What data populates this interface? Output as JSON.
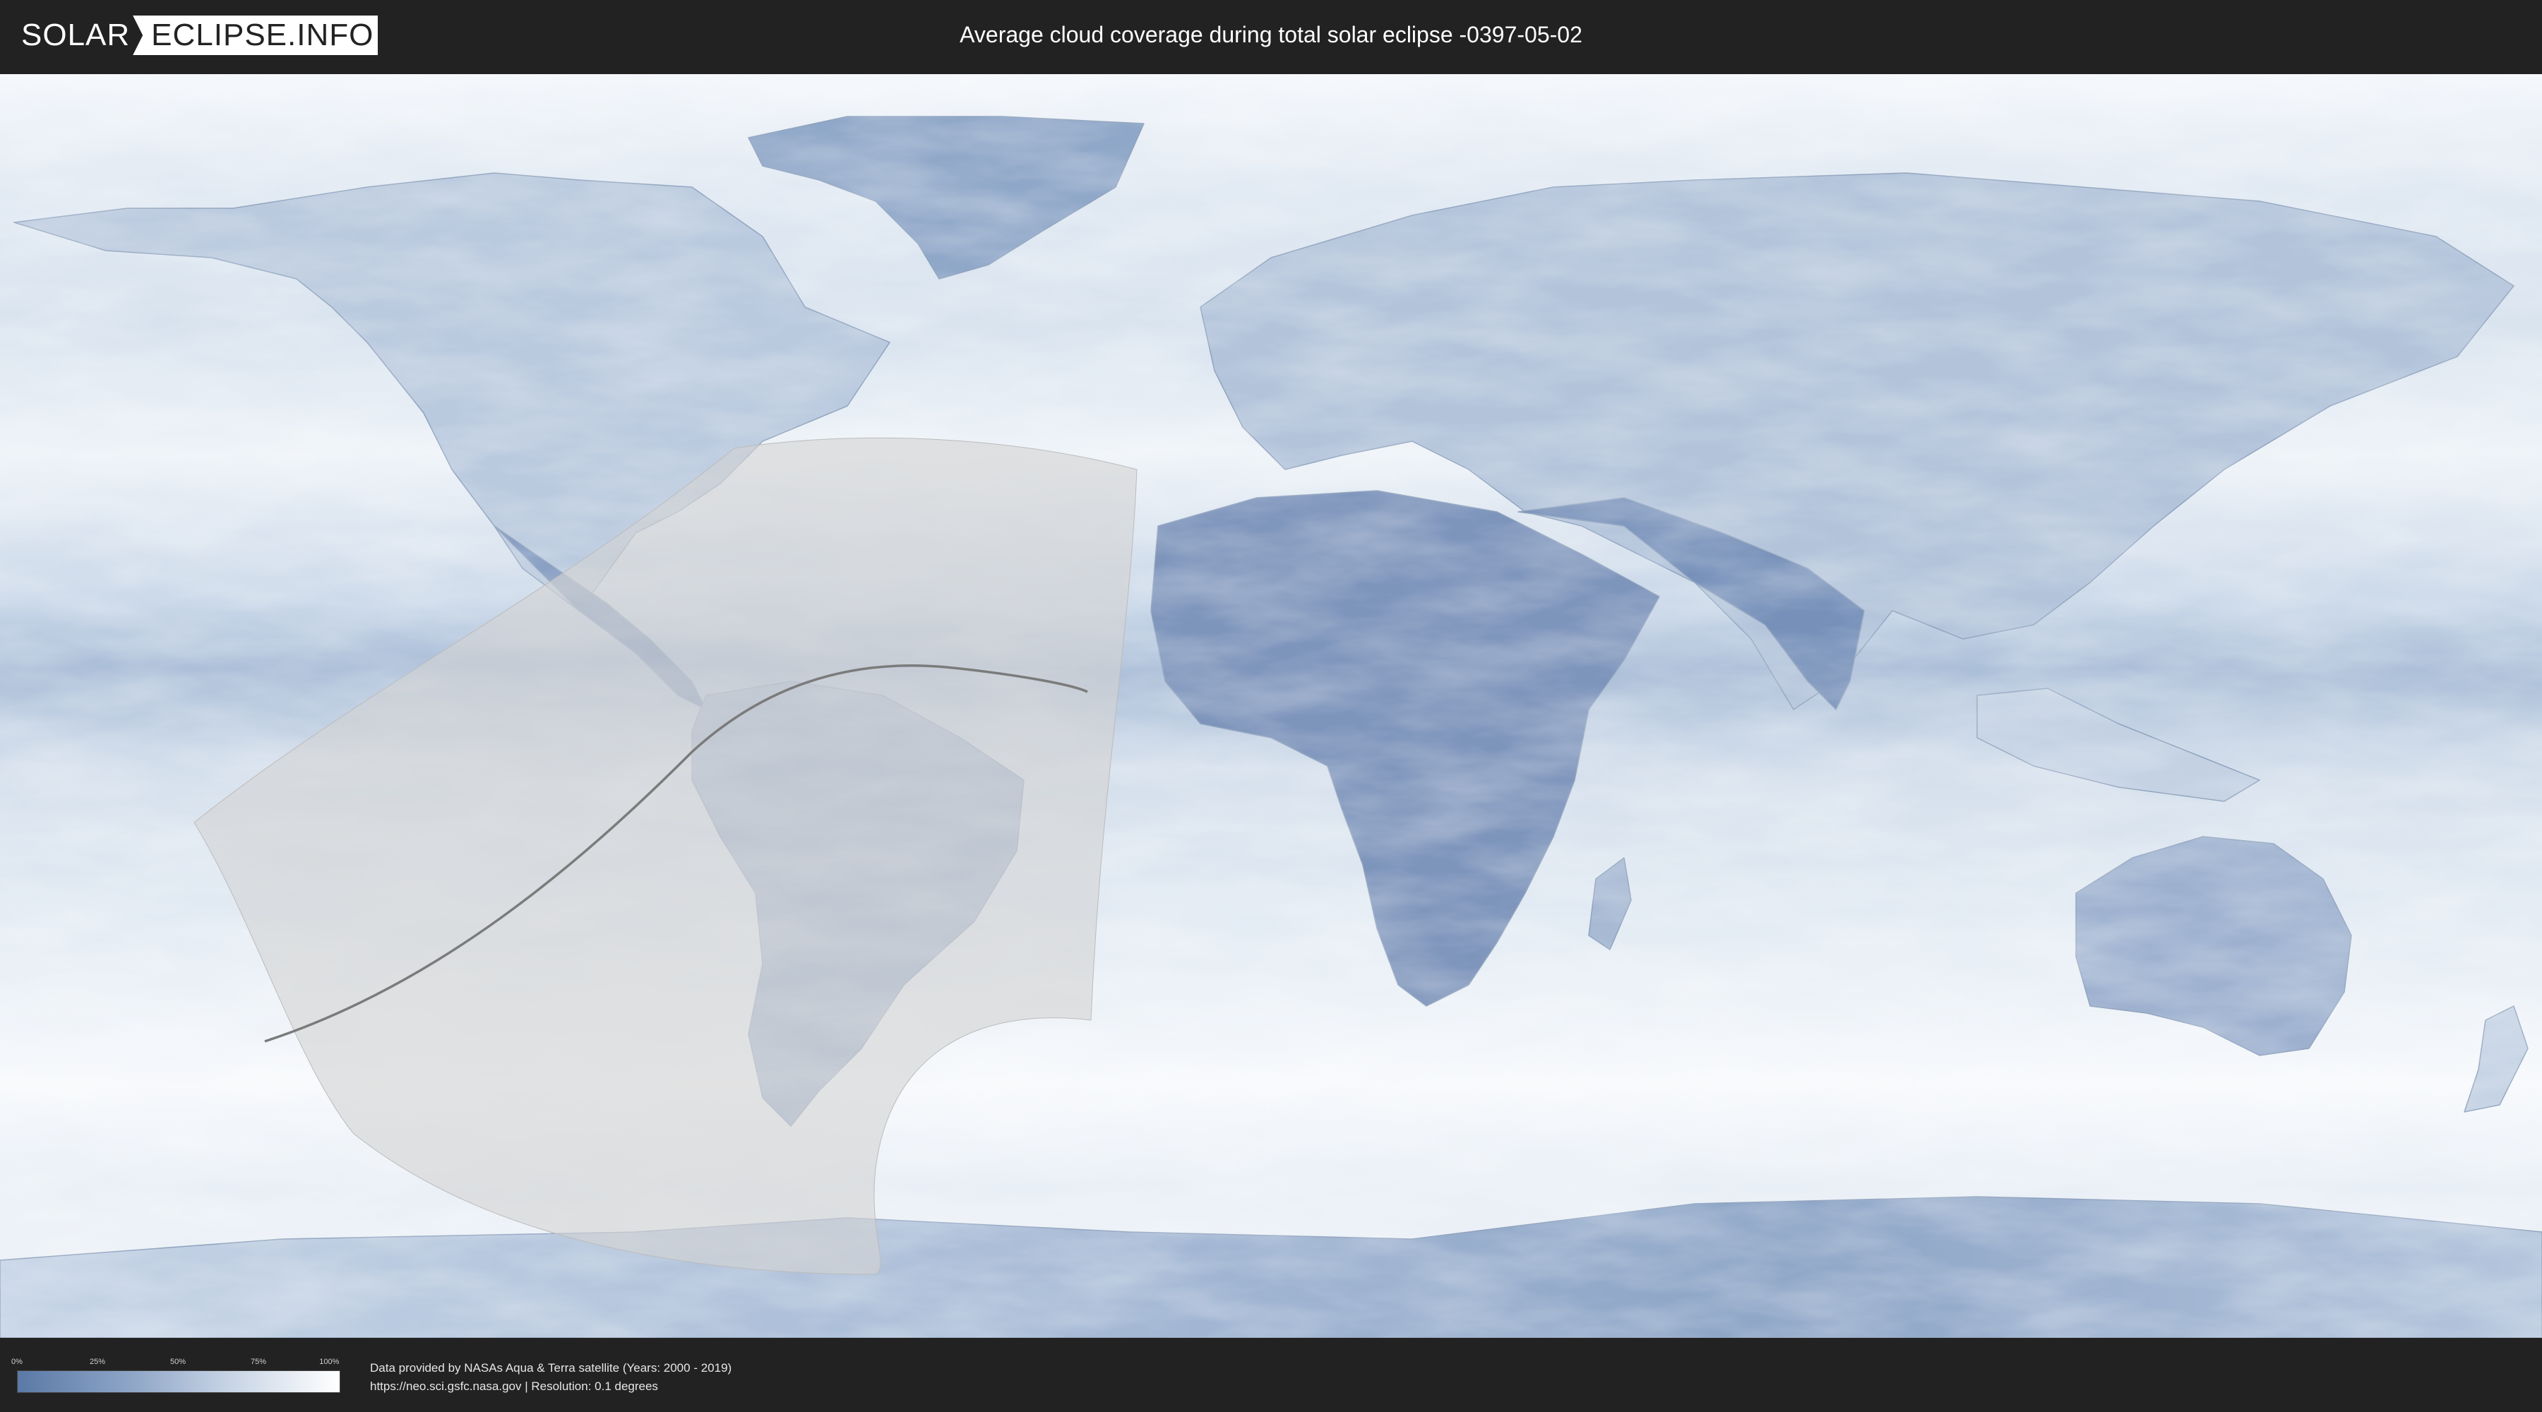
{
  "header": {
    "logo_left": "SOLAR",
    "logo_right": "ECLIPSE.INFO",
    "title": "Average cloud coverage during total solar eclipse -0397-05-02"
  },
  "legend": {
    "ticks": [
      "0%",
      "25%",
      "50%",
      "75%",
      "100%"
    ],
    "colors": {
      "low": "#5a79a6",
      "high": "#ffffff"
    }
  },
  "footer": {
    "credit_line1": "Data provided by NASAs Aqua & Terra satellite (Years: 2000 - 2019)",
    "credit_line2": "https://neo.sci.gsfc.nasa.gov | Resolution: 0.1 degrees"
  },
  "colors": {
    "background": "#222222",
    "ocean_cloud": "#dfe7f1",
    "land_clear": "#6d87b3",
    "eclipse_overlay": "#d0d0d0",
    "path_line": "#777777"
  }
}
